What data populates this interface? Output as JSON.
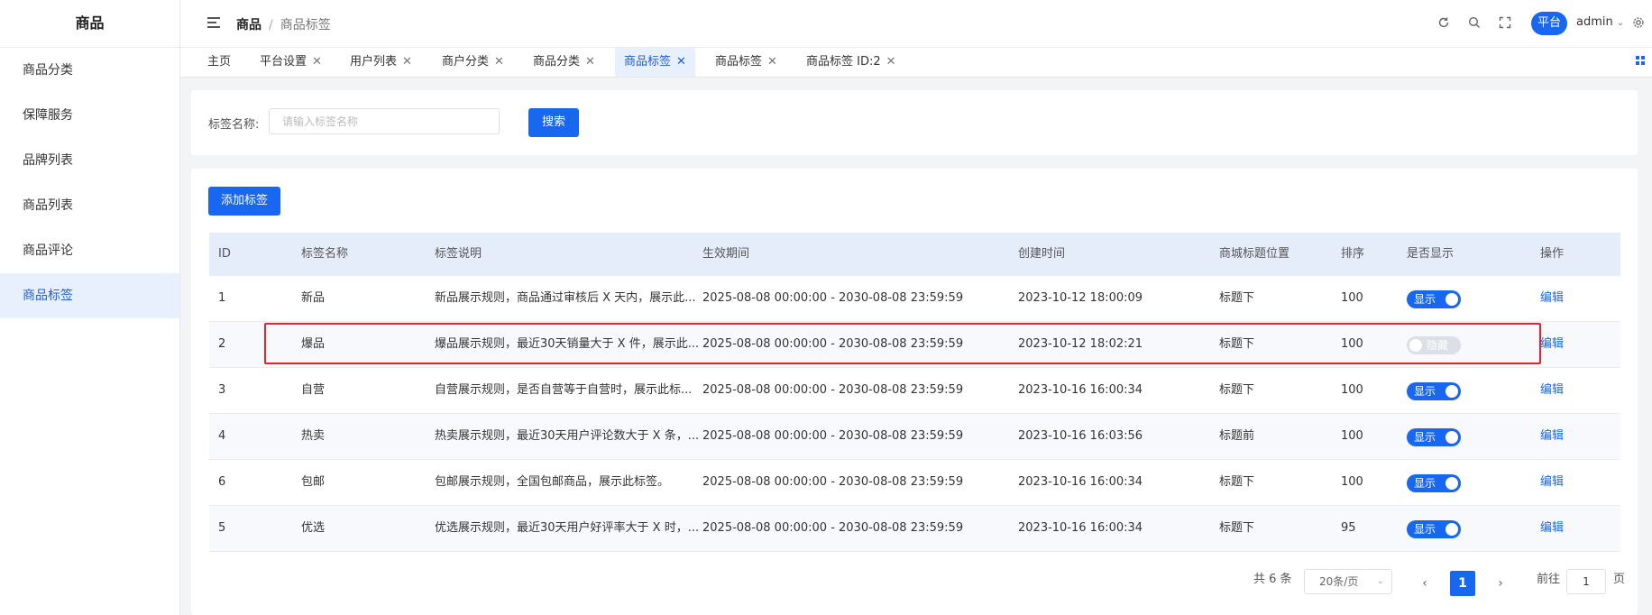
{
  "sidebar": {
    "title": "商品",
    "items": [
      {
        "label": "商品分类"
      },
      {
        "label": "保障服务"
      },
      {
        "label": "品牌列表"
      },
      {
        "label": "商品列表"
      },
      {
        "label": "商品评论"
      },
      {
        "label": "商品标签"
      }
    ],
    "active_index": 5
  },
  "header": {
    "breadcrumb": [
      "商品",
      "商品标签"
    ],
    "breadcrumb_sep": "/",
    "icons": [
      "refresh-icon",
      "search-icon",
      "fullscreen-icon",
      "settings-icon"
    ],
    "platform_label": "平台",
    "user": "admin"
  },
  "tabs": [
    {
      "label": "主页",
      "closable": false
    },
    {
      "label": "平台设置",
      "closable": true
    },
    {
      "label": "用户列表",
      "closable": true
    },
    {
      "label": "商户分类",
      "closable": true
    },
    {
      "label": "商品分类",
      "closable": true
    },
    {
      "label": "商品标签",
      "closable": true,
      "active": true
    },
    {
      "label": "商品标签",
      "closable": true
    },
    {
      "label": "商品标签 ID:2",
      "closable": true
    }
  ],
  "search": {
    "label": "标签名称:",
    "placeholder": "请输入标签名称",
    "value": "",
    "button": "搜索"
  },
  "toolbar": {
    "add_label": "添加标签"
  },
  "table": {
    "columns": [
      "ID",
      "标签名称",
      "标签说明",
      "生效期间",
      "创建时间",
      "商城标题位置",
      "排序",
      "是否显示",
      "操作"
    ],
    "rows": [
      {
        "id": "1",
        "name": "新品",
        "desc": "新品展示规则，商品通过审核后 X 天内，展示此...",
        "period": "2025-08-08 00:00:00 - 2030-08-08 23:59:59",
        "created": "2023-10-12 18:00:09",
        "position": "标题下",
        "sort": "100",
        "show": true,
        "show_label": "显示",
        "action": "编辑"
      },
      {
        "id": "2",
        "name": "爆品",
        "desc": "爆品展示规则，最近30天销量大于 X 件，展示此...",
        "period": "2025-08-08 00:00:00 - 2030-08-08 23:59:59",
        "created": "2023-10-12 18:02:21",
        "position": "标题下",
        "sort": "100",
        "show": false,
        "show_label": "隐藏",
        "action": "编辑"
      },
      {
        "id": "3",
        "name": "自营",
        "desc": "自营展示规则，是否自营等于自营时，展示此标...",
        "period": "2025-08-08 00:00:00 - 2030-08-08 23:59:59",
        "created": "2023-10-16 16:00:34",
        "position": "标题下",
        "sort": "100",
        "show": true,
        "show_label": "显示",
        "action": "编辑"
      },
      {
        "id": "4",
        "name": "热卖",
        "desc": "热卖展示规则，最近30天用户评论数大于 X 条，...",
        "period": "2025-08-08 00:00:00 - 2030-08-08 23:59:59",
        "created": "2023-10-16 16:03:56",
        "position": "标题前",
        "sort": "100",
        "show": true,
        "show_label": "显示",
        "action": "编辑"
      },
      {
        "id": "6",
        "name": "包邮",
        "desc": "包邮展示规则，全国包邮商品，展示此标签。",
        "period": "2025-08-08 00:00:00 - 2030-08-08 23:59:59",
        "created": "2023-10-16 16:00:34",
        "position": "标题下",
        "sort": "100",
        "show": true,
        "show_label": "显示",
        "action": "编辑"
      },
      {
        "id": "5",
        "name": "优选",
        "desc": "优选展示规则，最近30天用户好评率大于 X 时，...",
        "period": "2025-08-08 00:00:00 - 2030-08-08 23:59:59",
        "created": "2023-10-16 16:00:34",
        "position": "标题下",
        "sort": "95",
        "show": true,
        "show_label": "显示",
        "action": "编辑"
      }
    ]
  },
  "pagination": {
    "total": "共 6 条",
    "page_size": "20条/页",
    "current_page": "1",
    "goto_label": "前往",
    "goto_value": "1",
    "page_suffix": "页"
  },
  "colors": {
    "accent": "#1767f1",
    "highlight": "#e5232d",
    "active_bg": "#e8f0fd"
  }
}
